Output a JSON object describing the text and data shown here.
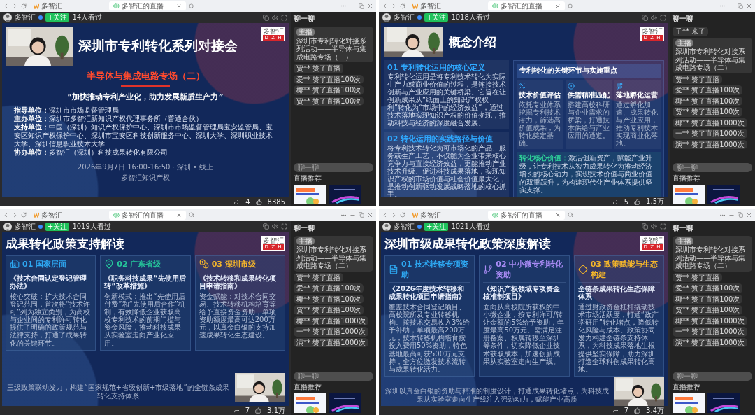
{
  "panels": [
    {
      "tabs": [
        {
          "label": "多智汇",
          "selected": false
        },
        {
          "label": "多智汇的直播",
          "selected": true
        }
      ],
      "host": "多智汇",
      "follow": "+关注",
      "viewers": "14人看过",
      "shares": "4",
      "likes": "8385",
      "slide": {
        "kind": "cover",
        "logo": {
          "name": "多智汇",
          "letters": "D Z H"
        },
        "title": "深圳市专利转化系列对接会",
        "subtitle": "半导体与集成电路专场（二）",
        "quote": "“加快推动专利产业化，助力发展新质生产力”",
        "credits": [
          "**指导单位：**深圳市市场监督管理局",
          "**主办单位：**深圳市多智汇新知识产权代理事务所（普通合伙）",
          "**支持单位：**中国（深圳）知识产权保护中心、深圳市市场监督管理局宝安监管局、宝安区知识产权保护中心、深圳市宝安区科技创新服务中心、深圳大学、深圳职业技术大学、深圳信息职业技术大学",
          "**协办单位：**多智汇（深圳）科技成果转化有限公司"
        ],
        "date": "2026年9月7日 16:00-16:50 · 深圳 • 线上",
        "organizer": "多智汇知识产权"
      },
      "chat": {
        "title": "聊一聊",
        "messages": [
          {
            "kind": "host",
            "tag": "主播",
            "text": "深圳市专利转化对接系列活动——半导体与集成电路专场（二）"
          },
          {
            "kind": "event",
            "text": "贾** 赞了直播"
          },
          {
            "kind": "event",
            "text": "爱** 赞了直播100次"
          },
          {
            "kind": "event",
            "text": "椰** 赞了直播100次"
          },
          {
            "kind": "event",
            "text": "贾** 赞了直播100次"
          }
        ],
        "placeholder": "聊一聊",
        "recommend": "直播推荐"
      }
    },
    {
      "tabs": [
        {
          "label": "多智汇",
          "selected": false
        },
        {
          "label": "多智汇的直播",
          "selected": true
        }
      ],
      "host": "多智汇",
      "follow": "+关注",
      "viewers": "1018人看过",
      "shares": "5",
      "likes": "1.5万",
      "slide": {
        "kind": "split",
        "logo": {
          "name": "多智汇",
          "letters": "D Z H"
        },
        "title": "概念介绍",
        "sections": [
          {
            "heading": "01 专利转化运用的核心定义",
            "body": "专利转化运用是将专利技术转化为实际生产力或商业价值的过程，是连接技术创新与产业应用的关键桥梁。它旨在让创新成果从“纸面上的知识产权权利”转化为“市场中的经济效益”，通过技术落地实现知识产权的价值变现，推动科技与经济的深度融合发展。"
          },
          {
            "heading": "02 转化运用的实践路径与价值",
            "body": "将专利技术转化为可市场化的产品、服务或生产工艺，不仅能为企业带来核心竞争力与直接经济效益，更能推动产业技术升级、促进科技成果落地，实现知识产权的市场价值与社会价值最大化，是推动创新驱动发展战略落地的核心抓手。"
          }
        ],
        "panel": {
          "title": "专利转化的关键环节与实施重点",
          "steps": [
            {
              "title": "技术价值评估",
              "body": "依托专业体系挖掘专利技术潜力，筛选高价值成果，为转化奠定基础。"
            },
            {
              "title": "供需精准匹配",
              "body": "搭建高校科研与企业需求的桥梁，打通技术供给与产业应用的通道。"
            },
            {
              "title": "落地孵化运营",
              "body": "通过孵化加速、成果转化与产业应用，推动专利技术实现商业化落地。"
            }
          ],
          "core": "**转化核心价值：**激活创新资产，赋能产业升级，让专利技术从智力成果转化为推动经济增长的核心动力，实现技术价值与商业价值的双重跃升，为构建现代化产业体系提供坚实支撑。"
        }
      },
      "chat": {
        "title": "聊一聊",
        "messages": [
          {
            "kind": "event",
            "text": "子** 来了"
          },
          {
            "kind": "host",
            "tag": "主播",
            "text": "深圳市专利转化对接系列活动——半导体与集成电路专场（二）"
          },
          {
            "kind": "event",
            "text": "贾** 赞了直播"
          },
          {
            "kind": "event",
            "text": "爱** 赞了直播100次"
          },
          {
            "kind": "event",
            "text": "椰** 赞了直播100次"
          },
          {
            "kind": "event",
            "text": "贾** 赞了直播100次"
          },
          {
            "kind": "event",
            "text": "椰** 赞了直播1000次"
          },
          {
            "kind": "event",
            "text": "一** 赞了直播1000次"
          },
          {
            "kind": "event",
            "text": "演** 赞了直播1000次"
          }
        ],
        "placeholder": "聊一聊",
        "recommend": "直播推荐"
      }
    },
    {
      "tabs": [
        {
          "label": "多智汇",
          "selected": false
        },
        {
          "label": "多智汇的直播",
          "selected": true
        }
      ],
      "host": "多智汇",
      "follow": "+关注",
      "viewers": "1019人看过",
      "shares": "7",
      "likes": "3.1万",
      "slide": {
        "kind": "cards",
        "logo": {
          "name": "多智汇",
          "letters": "D Z H"
        },
        "title": "成果转化政策支持解读",
        "cards": [
          {
            "heading": "01 国家层面",
            "color": "#2ea8f2",
            "doc": "《技术合同认定登记管理办法》",
            "body": "核心突破：扩大技术合同登记范围，首次将“技术许可”列为独立类别，为高校与企业间的专利许可转化提供了明确的政策规范与法律支持，打通了成果转化的关键环节。"
          },
          {
            "heading": "02 广东省级",
            "color": "#26c79b",
            "doc": "《职务科技成果“先使用后转”改革措施》",
            "body": "创新模式：推出“先使用后付费”和“先使用后合作”机制，有效降低企业获取高校专利技术的前期门槛与资金风险，推动科技成果从实验室走向产业化应用。"
          },
          {
            "heading": "03 深圳市级",
            "color": "#f5b62a",
            "doc": "《技术转移和成果转化项目申请指南》",
            "body": "资金赋能：对技术合同交易、技术转移机构培育等给予直接资金资助，单项资助额度最高可达200万元，以真金白银的支持加速成果转化生态建设。"
          }
        ],
        "footer": "三级政策联动发力，构建“国家规范+省级创新+市级落地”的全链条成果转化支持体系"
      },
      "chat": {
        "title": "聊一聊",
        "messages": [
          {
            "kind": "host",
            "tag": "主播",
            "text": "深圳市专利转化对接系列活动——半导体与集成电路专场（二）"
          },
          {
            "kind": "event",
            "text": "贾** 赞了直播"
          },
          {
            "kind": "event",
            "text": "爱** 赞了直播100次"
          },
          {
            "kind": "event",
            "text": "椰** 赞了直播100次"
          },
          {
            "kind": "event",
            "text": "贾** 赞了直播100次"
          },
          {
            "kind": "event",
            "text": "椰** 赞了直播1000次"
          },
          {
            "kind": "event",
            "text": "一** 赞了直播1000次"
          },
          {
            "kind": "event",
            "text": "演** 赞了直播1000次"
          }
        ],
        "placeholder": "聊一聊",
        "recommend": "直播推荐"
      }
    },
    {
      "tabs": [
        {
          "label": "多智汇",
          "selected": false
        },
        {
          "label": "多智汇的直播",
          "selected": true
        }
      ],
      "host": "多智汇",
      "follow": "+关注",
      "viewers": "1021人看过",
      "shares": "7",
      "likes": "3.4万",
      "slide": {
        "kind": "cards",
        "logo": {
          "name": "多智汇",
          "letters": "D Z H"
        },
        "title": "深圳市级成果转化政策深度解读",
        "cards": [
          {
            "heading": "01 技术转移专项资助",
            "color": "#2ea8f2",
            "doc": "《2026年度技术转移和成果转化项目申请指南》",
            "body": "覆盖技术合同登记项目、高校院所及专业转移机构。按技术交易收入3%给予补助，单项最高200万元；技术转移机构培育按投入费用50%资助，特色基地最高可获500万元支持，全方位激发技术流转与成果转化活力。"
          },
          {
            "heading": "02 中小微专利转化资助",
            "color": "#a98bf5",
            "doc": "《知识产权领域专项资金核准制项目》",
            "body": "面向从高校院所获权的中小微企业，按专利许可/转让金额的5%给予资助，年度最高50万元。需满足注册备案、权属转移至深圳等条件，切实降低企业技术获取成本，加速创新成果从实验室走向生产线。"
          },
          {
            "heading": "03 政策赋能与生态构建",
            "color": "#f5b62a",
            "doc": "全链条成果转化生态保障体系",
            "body": "通过财政资金杠杆撬动技术市场活跃度，打通“政产学研用”转化堵点，降低转化风险与成本。政策协同发力构建全链条支持体系，为科技成果落地生根提供坚实保障，助力深圳打造全球科创成果转化高地。"
          }
        ],
        "footer": "深圳以真金白银的资助与精准的制度设计，打通成果转化堵点，为科技成果从实验室走向生产线注入强劲动力，赋能产业高质"
      },
      "chat": {
        "title": "聊一聊",
        "messages": [
          {
            "kind": "host",
            "tag": "主播",
            "text": "深圳市专利转化对接系列活动——半导体与集成电路专场（二）"
          },
          {
            "kind": "event",
            "text": "贾** 赞了直播"
          },
          {
            "kind": "event",
            "text": "爱** 赞了直播100次"
          },
          {
            "kind": "event",
            "text": "椰** 赞了直播100次"
          },
          {
            "kind": "event",
            "text": "贾** 赞了直播100次"
          },
          {
            "kind": "event",
            "text": "椰** 赞了直播1000次"
          },
          {
            "kind": "event",
            "text": "一** 赞了直播1000次"
          },
          {
            "kind": "event",
            "text": "演** 赞了直播1000次"
          }
        ],
        "placeholder": "聊一聊",
        "recommend": "直播推荐"
      }
    }
  ]
}
